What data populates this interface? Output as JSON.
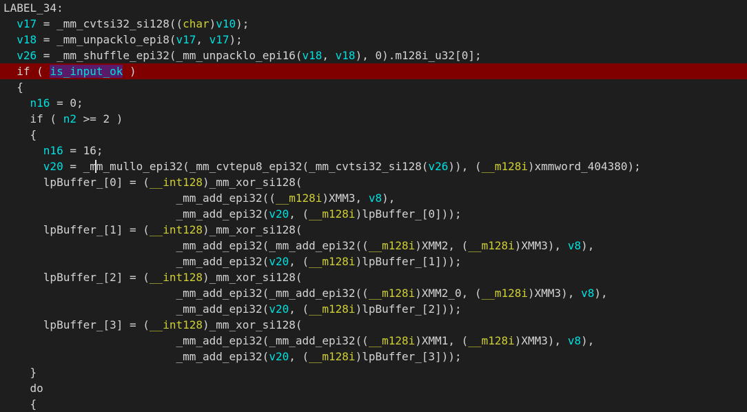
{
  "editor": {
    "caret_line": 10,
    "highlight_line": 4,
    "lines": [
      {
        "tokens": [
          [
            "LABEL_34:",
            "p"
          ]
        ]
      },
      {
        "tokens": [
          [
            "  ",
            "p"
          ],
          [
            "v17",
            "v"
          ],
          [
            " = _mm_cvtsi32_si128((",
            "p"
          ],
          [
            "char",
            "t"
          ],
          [
            ")",
            "p"
          ],
          [
            "v10",
            "v"
          ],
          [
            ");",
            "p"
          ]
        ]
      },
      {
        "tokens": [
          [
            "  ",
            "p"
          ],
          [
            "v18",
            "v"
          ],
          [
            " = _mm_unpacklo_epi8(",
            "p"
          ],
          [
            "v17",
            "v"
          ],
          [
            ", ",
            "p"
          ],
          [
            "v17",
            "v"
          ],
          [
            ");",
            "p"
          ]
        ]
      },
      {
        "tokens": [
          [
            "  ",
            "p"
          ],
          [
            "v26",
            "v"
          ],
          [
            " = _mm_shuffle_epi32(_mm_unpacklo_epi16(",
            "p"
          ],
          [
            "v18",
            "v"
          ],
          [
            ", ",
            "p"
          ],
          [
            "v18",
            "v"
          ],
          [
            "), 0).m128i_u32[0];",
            "p"
          ]
        ]
      },
      {
        "tokens": [
          [
            "  if ( ",
            "p"
          ],
          [
            "is_input_ok",
            "s"
          ],
          [
            " )",
            "p"
          ]
        ]
      },
      {
        "tokens": [
          [
            "  {",
            "p"
          ]
        ]
      },
      {
        "tokens": [
          [
            "    ",
            "p"
          ],
          [
            "n16",
            "v"
          ],
          [
            " = 0;",
            "p"
          ]
        ]
      },
      {
        "tokens": [
          [
            "    if ( ",
            "p"
          ],
          [
            "n2",
            "v"
          ],
          [
            " >= 2 )",
            "p"
          ]
        ]
      },
      {
        "tokens": [
          [
            "    {",
            "p"
          ]
        ]
      },
      {
        "tokens": [
          [
            "      ",
            "p"
          ],
          [
            "n16",
            "v"
          ],
          [
            " = 16;",
            "p"
          ]
        ]
      },
      {
        "tokens": [
          [
            "      ",
            "p"
          ],
          [
            "v20",
            "v"
          ],
          [
            " = _mm_mullo_epi32(_mm_cvtepu8_epi32(_mm_cvtsi32_si128(",
            "p"
          ],
          [
            "v26",
            "v"
          ],
          [
            ")), (",
            "p"
          ],
          [
            "__m128i",
            "t"
          ],
          [
            ")xmmword_404380);",
            "p"
          ]
        ]
      },
      {
        "tokens": [
          [
            "      lpBuffer_[0] = (",
            "p"
          ],
          [
            "__int128",
            "t"
          ],
          [
            ")_mm_xor_si128(",
            "p"
          ]
        ]
      },
      {
        "tokens": [
          [
            "                          _mm_add_epi32((",
            "p"
          ],
          [
            "__m128i",
            "t"
          ],
          [
            ")XMM3, ",
            "p"
          ],
          [
            "v8",
            "v"
          ],
          [
            "),",
            "p"
          ]
        ]
      },
      {
        "tokens": [
          [
            "                          _mm_add_epi32(",
            "p"
          ],
          [
            "v20",
            "v"
          ],
          [
            ", (",
            "p"
          ],
          [
            "__m128i",
            "t"
          ],
          [
            ")lpBuffer_[0]));",
            "p"
          ]
        ]
      },
      {
        "tokens": [
          [
            "      lpBuffer_[1] = (",
            "p"
          ],
          [
            "__int128",
            "t"
          ],
          [
            ")_mm_xor_si128(",
            "p"
          ]
        ]
      },
      {
        "tokens": [
          [
            "                          _mm_add_epi32(_mm_add_epi32((",
            "p"
          ],
          [
            "__m128i",
            "t"
          ],
          [
            ")XMM2, (",
            "p"
          ],
          [
            "__m128i",
            "t"
          ],
          [
            ")XMM3), ",
            "p"
          ],
          [
            "v8",
            "v"
          ],
          [
            "),",
            "p"
          ]
        ]
      },
      {
        "tokens": [
          [
            "                          _mm_add_epi32(",
            "p"
          ],
          [
            "v20",
            "v"
          ],
          [
            ", (",
            "p"
          ],
          [
            "__m128i",
            "t"
          ],
          [
            ")lpBuffer_[1]));",
            "p"
          ]
        ]
      },
      {
        "tokens": [
          [
            "      lpBuffer_[2] = (",
            "p"
          ],
          [
            "__int128",
            "t"
          ],
          [
            ")_mm_xor_si128(",
            "p"
          ]
        ]
      },
      {
        "tokens": [
          [
            "                          _mm_add_epi32(_mm_add_epi32((",
            "p"
          ],
          [
            "__m128i",
            "t"
          ],
          [
            ")XMM2_0, (",
            "p"
          ],
          [
            "__m128i",
            "t"
          ],
          [
            ")XMM3), ",
            "p"
          ],
          [
            "v8",
            "v"
          ],
          [
            "),",
            "p"
          ]
        ]
      },
      {
        "tokens": [
          [
            "                          _mm_add_epi32(",
            "p"
          ],
          [
            "v20",
            "v"
          ],
          [
            ", (",
            "p"
          ],
          [
            "__m128i",
            "t"
          ],
          [
            ")lpBuffer_[2]));",
            "p"
          ]
        ]
      },
      {
        "tokens": [
          [
            "      lpBuffer_[3] = (",
            "p"
          ],
          [
            "__int128",
            "t"
          ],
          [
            ")_mm_xor_si128(",
            "p"
          ]
        ]
      },
      {
        "tokens": [
          [
            "                          _mm_add_epi32(_mm_add_epi32((",
            "p"
          ],
          [
            "__m128i",
            "t"
          ],
          [
            ")XMM1, (",
            "p"
          ],
          [
            "__m128i",
            "t"
          ],
          [
            ")XMM3), ",
            "p"
          ],
          [
            "v8",
            "v"
          ],
          [
            "),",
            "p"
          ]
        ]
      },
      {
        "tokens": [
          [
            "                          _mm_add_epi32(",
            "p"
          ],
          [
            "v20",
            "v"
          ],
          [
            ", (",
            "p"
          ],
          [
            "__m128i",
            "t"
          ],
          [
            ")lpBuffer_[3]));",
            "p"
          ]
        ]
      },
      {
        "tokens": [
          [
            "    }",
            "p"
          ]
        ]
      },
      {
        "tokens": [
          [
            "    do",
            "p"
          ]
        ]
      },
      {
        "tokens": [
          [
            "    {",
            "p"
          ]
        ]
      }
    ]
  }
}
